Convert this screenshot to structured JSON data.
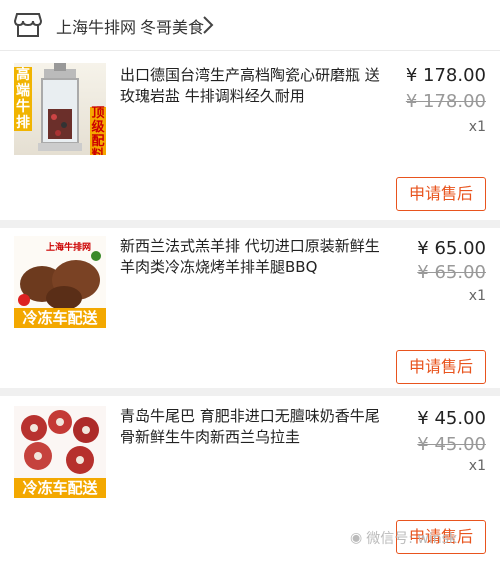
{
  "header": {
    "shop_name": "上海牛排网",
    "shop_sub": "冬哥美食"
  },
  "orders": [
    {
      "title": "出口德国台湾生产高档陶瓷心研磨瓶 送玫瑰岩盐 牛排调料经久耐用",
      "price": "¥ 178.00",
      "original_price": "¥ 178.00",
      "quantity": "x1",
      "button_label": "申请售后",
      "thumb_text": [
        "高端牛排",
        "顶级配料"
      ]
    },
    {
      "title": "新西兰法式羔羊排 代切进口原装新鲜生羊肉类冷冻烧烤羊排羊腿BBQ",
      "price": "¥ 65.00",
      "original_price": "¥ 65.00",
      "quantity": "x1",
      "button_label": "申请售后",
      "thumb_text": [
        "上海牛排网",
        "冷冻车配送"
      ]
    },
    {
      "title": "青岛牛尾巴 育肥非进口无膻味奶香牛尾骨新鲜生牛肉新西兰乌拉圭",
      "price": "¥ 45.00",
      "original_price": "¥ 45.00",
      "quantity": "x1",
      "button_label": "申请售后",
      "thumb_text": [
        "冷冻车配送"
      ]
    }
  ],
  "watermark": "微信号: winsk",
  "colors": {
    "accent": "#e8541e",
    "separator": "#f0f0f0"
  }
}
